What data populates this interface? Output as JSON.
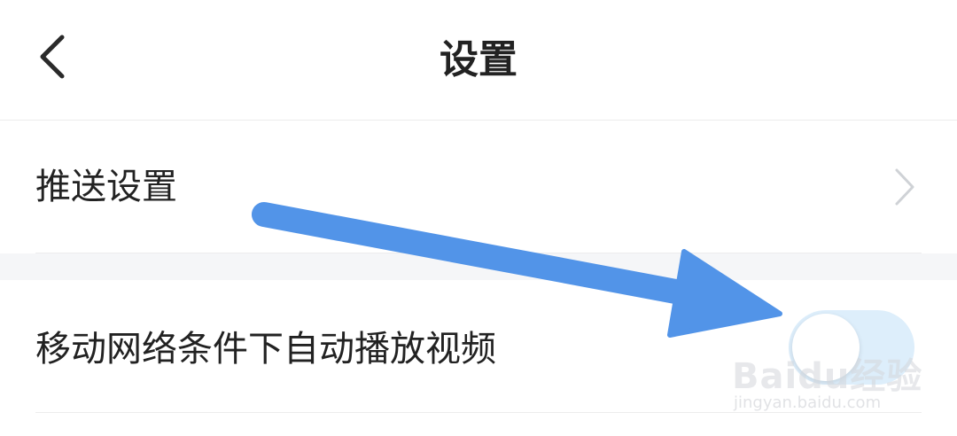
{
  "header": {
    "title": "设置",
    "back_icon": "chevron-left-icon"
  },
  "settings": {
    "push": {
      "label": "推送设置",
      "icon": "chevron-right-icon"
    },
    "autoplay": {
      "label": "移动网络条件下自动播放视频",
      "toggle_on": false
    }
  },
  "annotation": {
    "arrow_color": "#5294e8"
  },
  "watermark": {
    "brand": "Baidu经验",
    "url": "jingyan.baidu.com"
  },
  "colors": {
    "toggle_track": "#ddeefb",
    "divider": "#ececec",
    "section_gap": "#f5f6f8",
    "text": "#222222"
  }
}
